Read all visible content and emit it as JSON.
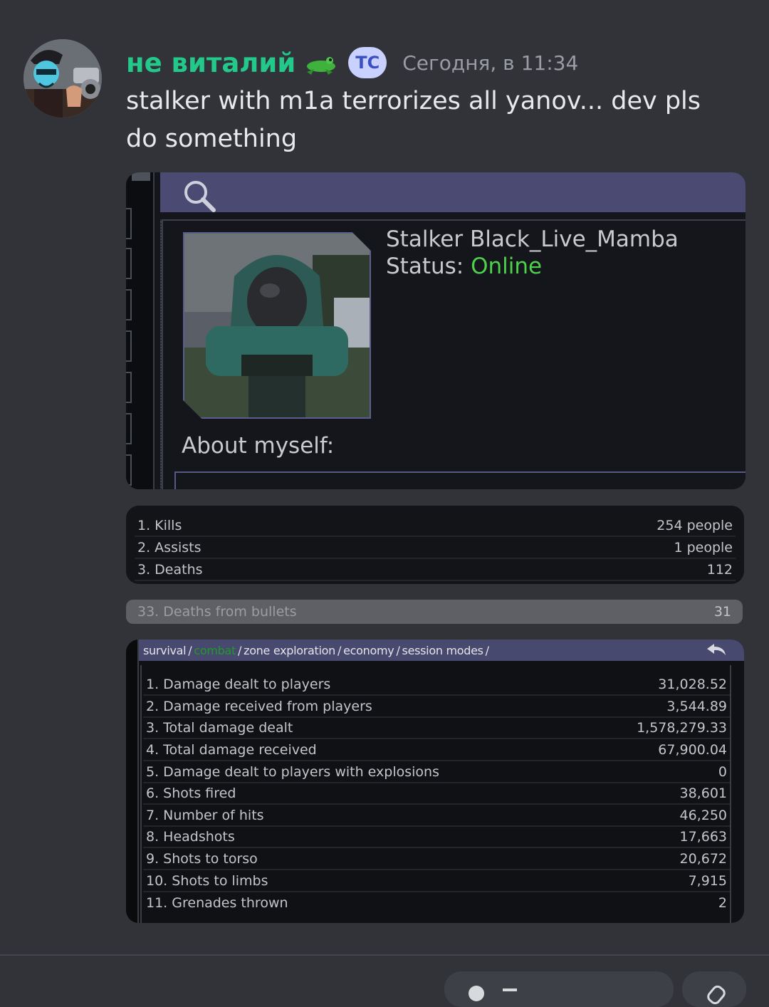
{
  "message": {
    "username": "не виталий",
    "tag": "TC",
    "timestamp": "Сегодня, в 11:34",
    "text": "stalker with m1a terrorizes all yanov... dev pls do something"
  },
  "profile": {
    "name": "Stalker Black_Live_Mamba",
    "status_label": "Status:",
    "status_value": "Online",
    "about_label": "About myself:"
  },
  "stats": [
    {
      "label": "1. Kills",
      "value": "254 people"
    },
    {
      "label": "2. Assists",
      "value": "1 people"
    },
    {
      "label": "3. Deaths",
      "value": "112"
    }
  ],
  "bullets_row": {
    "label": "33. Deaths from bullets",
    "value": "31"
  },
  "combat": {
    "nav": [
      "survival",
      "combat",
      "zone exploration",
      "economy",
      "session modes"
    ],
    "active_tab": "combat",
    "rows": [
      {
        "label": "1. Damage dealt to players",
        "value": "31,028.52"
      },
      {
        "label": "2. Damage received from players",
        "value": "3,544.89"
      },
      {
        "label": "3. Total damage dealt",
        "value": "1,578,279.33"
      },
      {
        "label": "4. Total damage received",
        "value": "67,900.04"
      },
      {
        "label": "5. Damage dealt to players with explosions",
        "value": "0"
      },
      {
        "label": "6. Shots fired",
        "value": "38,601"
      },
      {
        "label": "7. Number of hits",
        "value": "46,250"
      },
      {
        "label": "8. Headshots",
        "value": "17,663"
      },
      {
        "label": "9. Shots to torso",
        "value": "20,672"
      },
      {
        "label": "10. Shots to limbs",
        "value": "7,915"
      },
      {
        "label": "11. Grenades thrown",
        "value": "2"
      }
    ]
  },
  "colors": {
    "username": "#23c98a",
    "online": "#4cd14a",
    "active_tab": "#1f9a2a"
  }
}
